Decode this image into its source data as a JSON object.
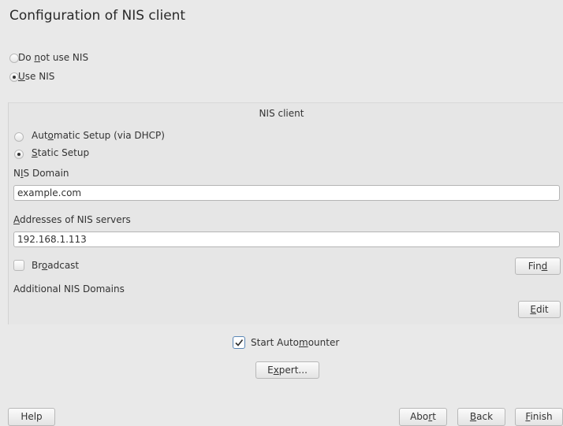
{
  "title": "Configuration of NIS client",
  "nis_mode": {
    "options": [
      {
        "pre": "Do ",
        "acc": "n",
        "post": "ot use NIS",
        "checked": false
      },
      {
        "pre": "",
        "acc": "U",
        "post": "se NIS",
        "checked": true
      }
    ]
  },
  "nis_client": {
    "heading": "NIS client",
    "setup_options": [
      {
        "pre": "Aut",
        "acc": "o",
        "post": "matic Setup (via DHCP)",
        "checked": false
      },
      {
        "pre": "",
        "acc": "S",
        "post": "tatic Setup",
        "checked": true
      }
    ],
    "domain_label": {
      "pre": "N",
      "acc": "I",
      "post": "S Domain"
    },
    "domain_value": "example.com",
    "servers_label": {
      "pre": "",
      "acc": "A",
      "post": "ddresses of NIS servers"
    },
    "servers_value": "192.168.1.113",
    "broadcast": {
      "pre": "Br",
      "acc": "o",
      "post": "adcast",
      "checked": false
    },
    "find_button": {
      "pre": "Fin",
      "acc": "d",
      "post": ""
    },
    "additional_label": "Additional NIS Domains",
    "edit_button": {
      "pre": "",
      "acc": "E",
      "post": "dit"
    }
  },
  "automounter": {
    "pre": "Start Auto",
    "acc": "m",
    "post": "ounter",
    "checked": true
  },
  "expert_button": {
    "pre": "E",
    "acc": "x",
    "post": "pert..."
  },
  "footer": {
    "help": "Help",
    "abort": {
      "pre": "Abo",
      "acc": "r",
      "post": "t"
    },
    "back": {
      "pre": "",
      "acc": "B",
      "post": "ack"
    },
    "finish": {
      "pre": "",
      "acc": "F",
      "post": "inish"
    }
  }
}
